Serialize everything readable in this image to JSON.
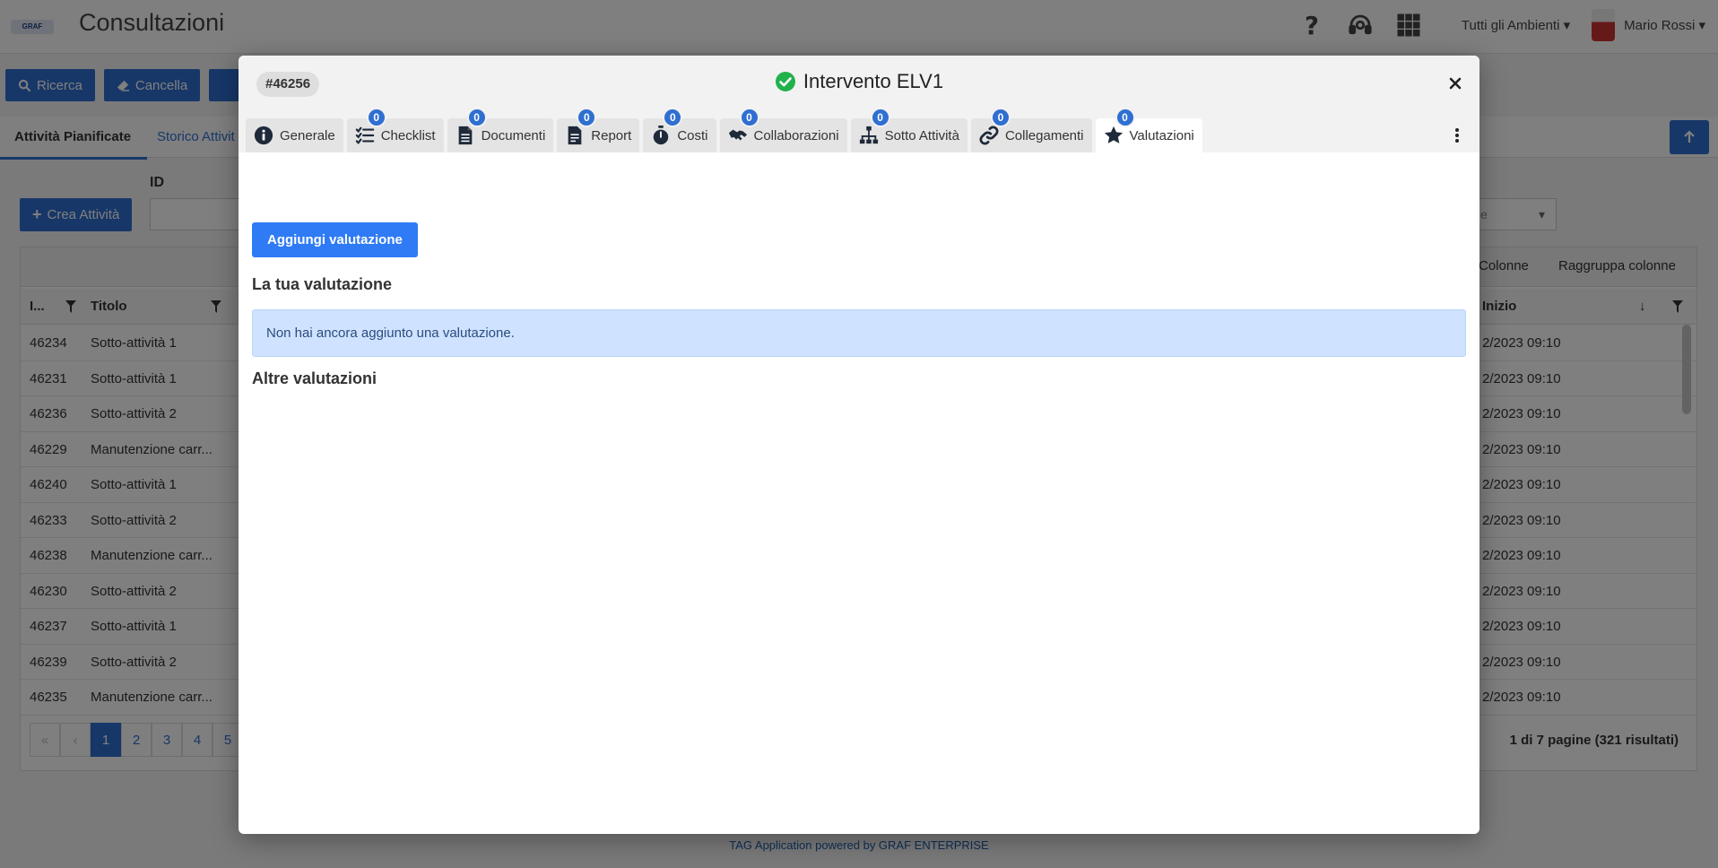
{
  "app": {
    "logo_text": "GRAF",
    "title": "Consultazioni",
    "env_select": "Tutti gli Ambienti ▾",
    "user_name": "Mario Rossi ▾"
  },
  "toolbar": {
    "search_label": "Ricerca",
    "clear_label": "Cancella"
  },
  "subtabs": {
    "planned": "Attività Pianificate",
    "history": "Storico Attivit"
  },
  "filters": {
    "create_label": "Crea Attività",
    "id_label": "ID",
    "right_select_partial": "e"
  },
  "grid": {
    "columns_btn": "Colonne",
    "group_btn": "Raggruppa colonne",
    "col_id": "I...",
    "col_title": "Titolo",
    "col_start": "Inizio",
    "rows": [
      {
        "id": "46234",
        "title": "Sotto-attività 1",
        "start": "2/2023 09:10"
      },
      {
        "id": "46231",
        "title": "Sotto-attività 1",
        "start": "2/2023 09:10"
      },
      {
        "id": "46236",
        "title": "Sotto-attività 2",
        "start": "2/2023 09:10"
      },
      {
        "id": "46229",
        "title": "Manutenzione carr...",
        "start": "2/2023 09:10"
      },
      {
        "id": "46240",
        "title": "Sotto-attività 1",
        "start": "2/2023 09:10"
      },
      {
        "id": "46233",
        "title": "Sotto-attività 2",
        "start": "2/2023 09:10"
      },
      {
        "id": "46238",
        "title": "Manutenzione carr...",
        "start": "2/2023 09:10"
      },
      {
        "id": "46230",
        "title": "Sotto-attività 2",
        "start": "2/2023 09:10"
      },
      {
        "id": "46237",
        "title": "Sotto-attività 1",
        "start": "2/2023 09:10"
      },
      {
        "id": "46239",
        "title": "Sotto-attività 2",
        "start": "2/2023 09:10"
      },
      {
        "id": "46235",
        "title": "Manutenzione carr...",
        "start": "2/2023 09:10"
      }
    ],
    "pager": {
      "first": "«",
      "prev": "‹",
      "pages": [
        "1",
        "2",
        "3",
        "4",
        "5"
      ],
      "info": "1 di 7 pagine (321 risultati)"
    }
  },
  "footer": "TAG Application powered by GRAF ENTERPRISE",
  "modal": {
    "id_badge": "#46256",
    "title": "Intervento ELV1",
    "tabs": [
      {
        "label": "Generale",
        "icon": "info-circle-icon"
      },
      {
        "label": "Checklist",
        "badge": "0",
        "icon": "checklist-icon"
      },
      {
        "label": "Documenti",
        "badge": "0",
        "icon": "document-icon"
      },
      {
        "label": "Report",
        "badge": "0",
        "icon": "report-icon"
      },
      {
        "label": "Costi",
        "badge": "0",
        "icon": "stopwatch-icon"
      },
      {
        "label": "Collaborazioni",
        "badge": "0",
        "icon": "handshake-icon"
      },
      {
        "label": "Sotto Attività",
        "badge": "0",
        "icon": "sitemap-icon"
      },
      {
        "label": "Collegamenti",
        "badge": "0",
        "icon": "link-icon"
      },
      {
        "label": "Valutazioni",
        "badge": "0",
        "icon": "star-icon"
      }
    ],
    "add_label": "Aggiungi valutazione",
    "your_title": "La tua valutazione",
    "empty_alert": "Non hai ancora aggiunto una valutazione.",
    "others_title": "Altre valutazioni"
  },
  "colors": {
    "primary": "#2f6fd1",
    "add_button": "#2f7bf5",
    "alert_bg": "#cfe2ff",
    "success": "#22b14c"
  }
}
